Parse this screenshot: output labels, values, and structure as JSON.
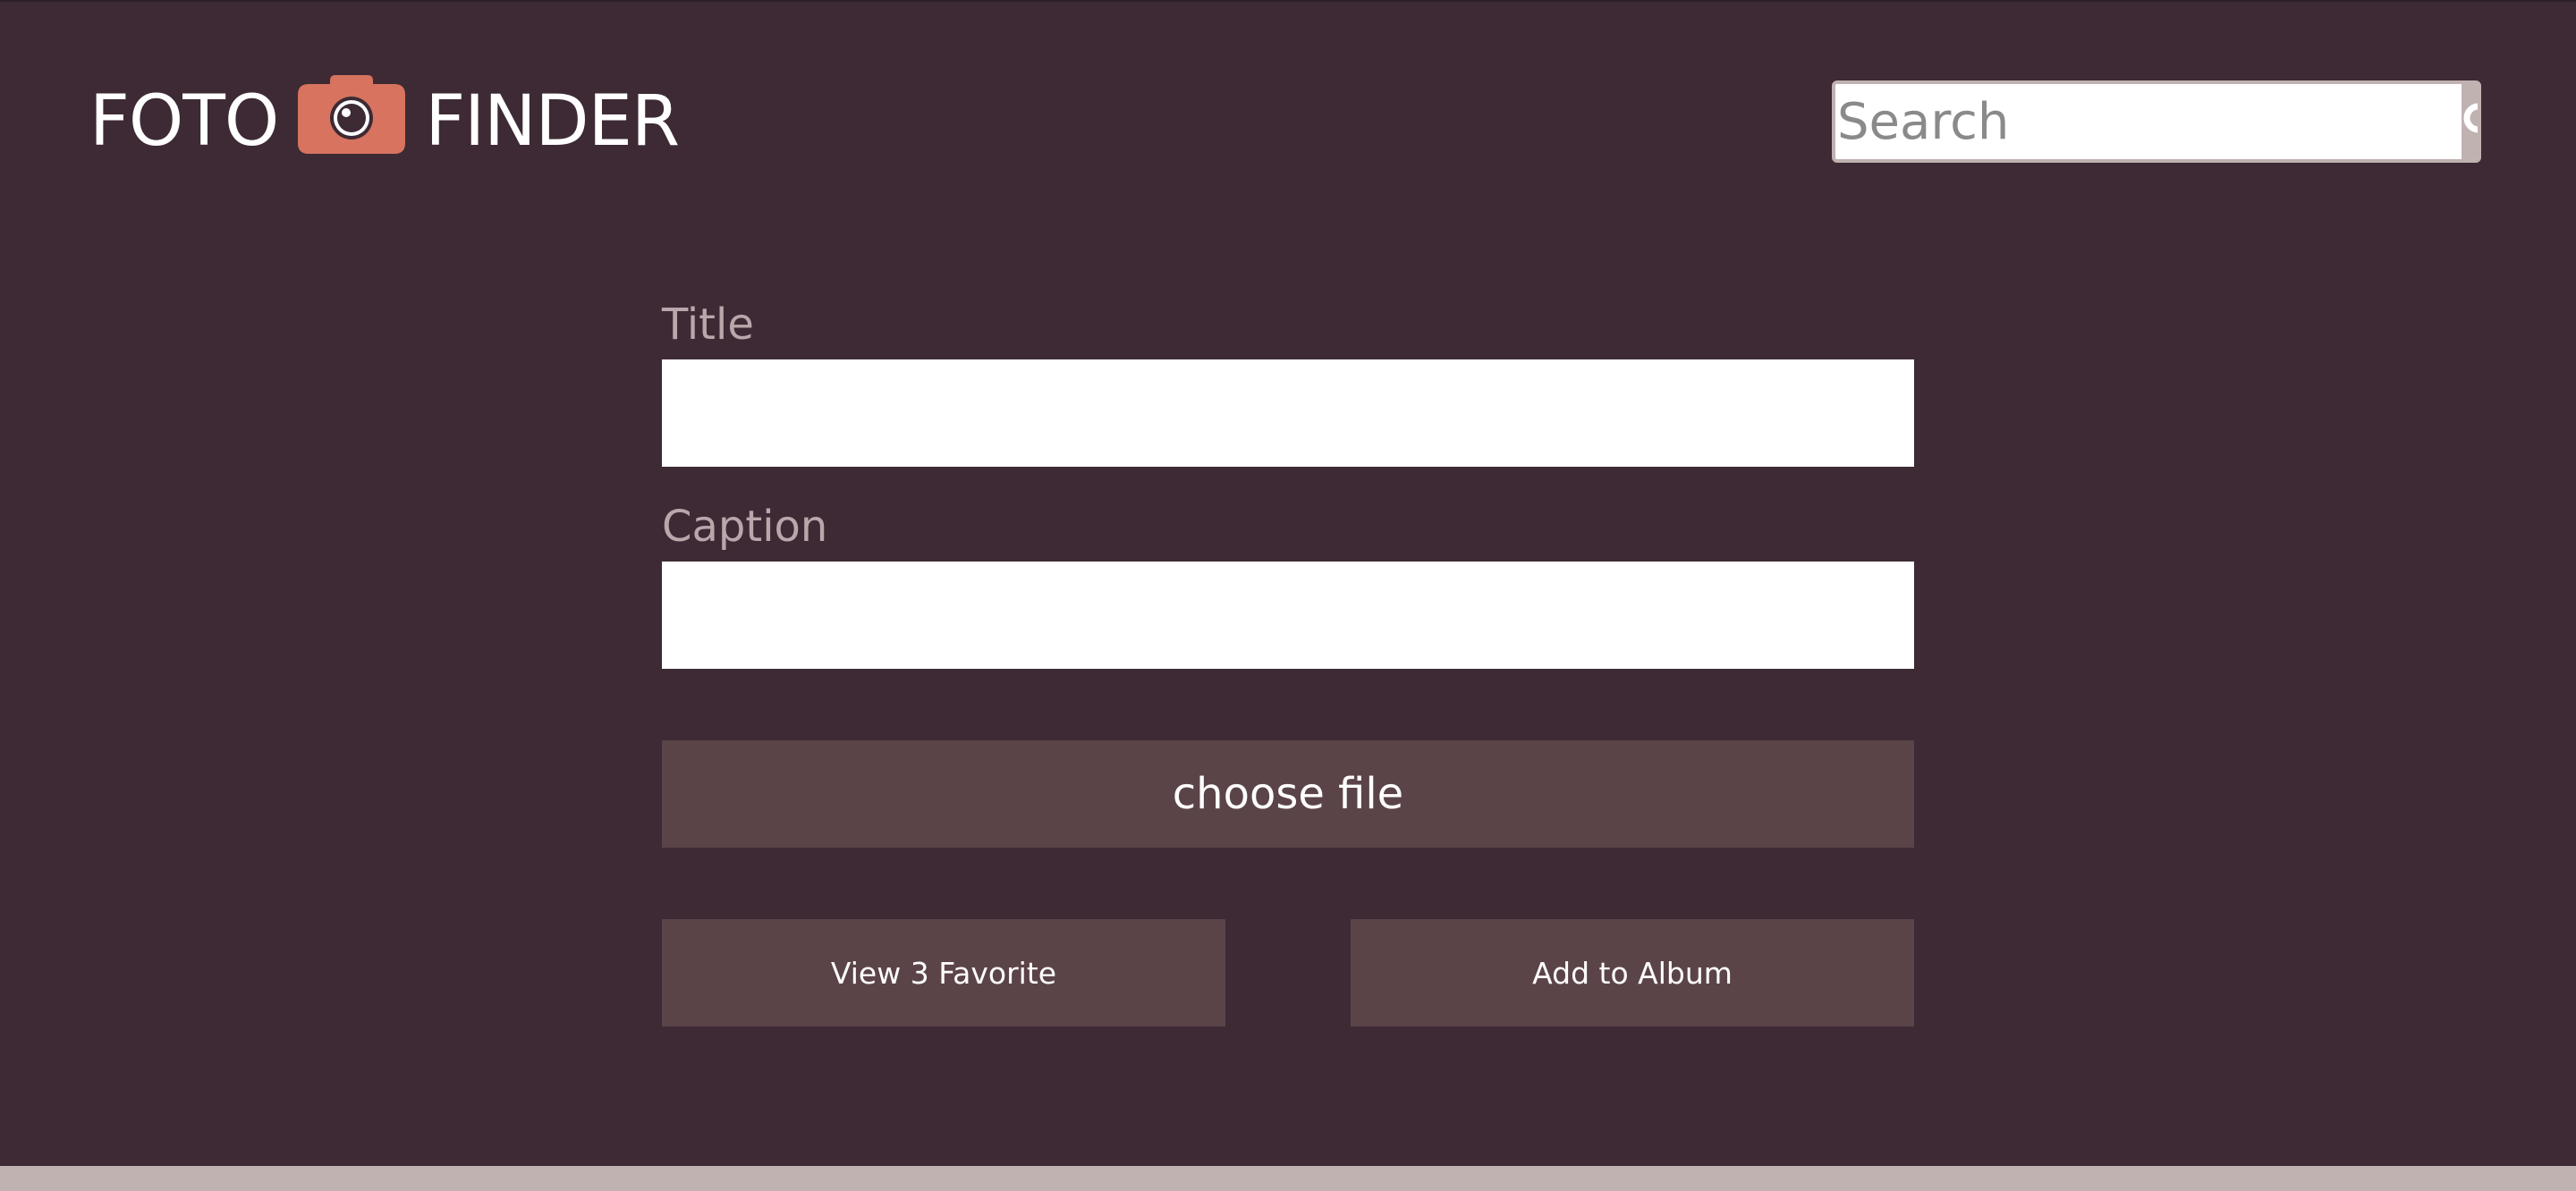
{
  "header": {
    "logo_left": "FOTO",
    "logo_right": "FINDER",
    "logo_icon": "camera-icon",
    "search": {
      "placeholder": "Search",
      "value": "",
      "icon": "search-icon"
    }
  },
  "form": {
    "title_label": "Title",
    "title_value": "",
    "caption_label": "Caption",
    "caption_value": "",
    "choose_file_label": "choose file",
    "view_favorites_label": "View 3 Favorite",
    "add_album_label": "Add to Album"
  },
  "colors": {
    "background": "#3d2a35",
    "button": "#5b4448",
    "accent": "#d8735f",
    "footer": "#c1b2b2"
  }
}
